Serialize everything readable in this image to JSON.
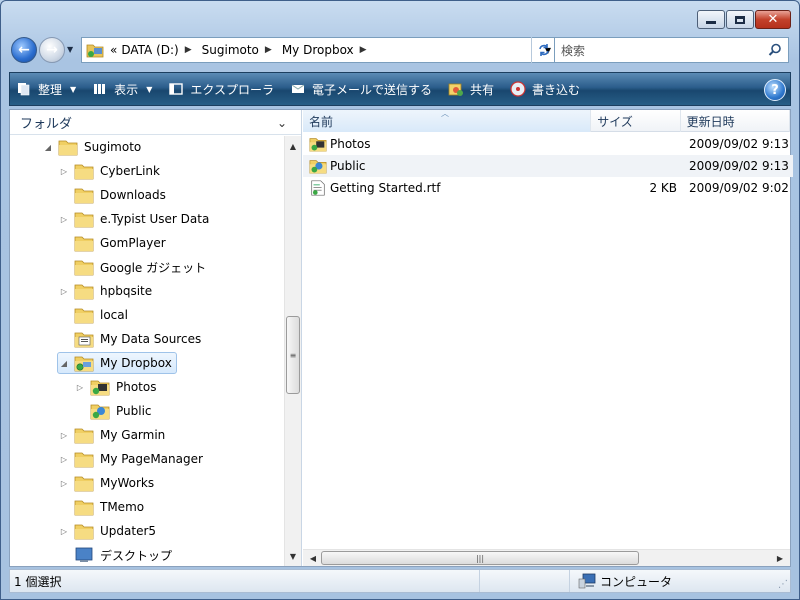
{
  "search": {
    "placeholder": "検索"
  },
  "address": {
    "overflow": "«",
    "crumbs": [
      "DATA (D:)",
      "Sugimoto",
      "My Dropbox"
    ]
  },
  "toolbar": {
    "organize": "整理",
    "views": "表示",
    "explorer": "エクスプローラ",
    "email": "電子メールで送信する",
    "share": "共有",
    "burn": "書き込む",
    "help": "?"
  },
  "leftpane": {
    "title": "フォルダ"
  },
  "tree": [
    {
      "label": "Sugimoto",
      "level": 0,
      "expanded": true
    },
    {
      "label": "CyberLink",
      "level": 1,
      "expander": true
    },
    {
      "label": "Downloads",
      "level": 1
    },
    {
      "label": "e.Typist User Data",
      "level": 1,
      "expander": true
    },
    {
      "label": "GomPlayer",
      "level": 1
    },
    {
      "label": "Google ガジェット",
      "level": 1
    },
    {
      "label": "hpbqsite",
      "level": 1,
      "expander": true
    },
    {
      "label": "local",
      "level": 1
    },
    {
      "label": "My Data Sources",
      "level": 1
    },
    {
      "label": "My Dropbox",
      "level": 1,
      "expanded": true,
      "selected": true
    },
    {
      "label": "Photos",
      "level": 2,
      "expander": true
    },
    {
      "label": "Public",
      "level": 2
    },
    {
      "label": "My Garmin",
      "level": 1,
      "expander": true
    },
    {
      "label": "My PageManager",
      "level": 1,
      "expander": true
    },
    {
      "label": "MyWorks",
      "level": 1,
      "expander": true
    },
    {
      "label": "TMemo",
      "level": 1
    },
    {
      "label": "Updater5",
      "level": 1,
      "expander": true
    },
    {
      "label": "デスクトップ",
      "level": 1
    }
  ],
  "filelist": {
    "columns": {
      "name": "名前",
      "size": "サイズ",
      "date": "更新日時"
    },
    "rows": [
      {
        "name": "Photos",
        "size": "",
        "date": "2009/09/02 9:13",
        "icon": "dropbox-folder-icon"
      },
      {
        "name": "Public",
        "size": "",
        "date": "2009/09/02 9:13",
        "icon": "dropbox-folder-icon",
        "highlight": true
      },
      {
        "name": "Getting Started.rtf",
        "size": "2 KB",
        "date": "2009/09/02 9:02",
        "icon": "rtf-file-icon"
      }
    ]
  },
  "status": {
    "selection": "1 個選択",
    "location": "コンピュータ"
  }
}
